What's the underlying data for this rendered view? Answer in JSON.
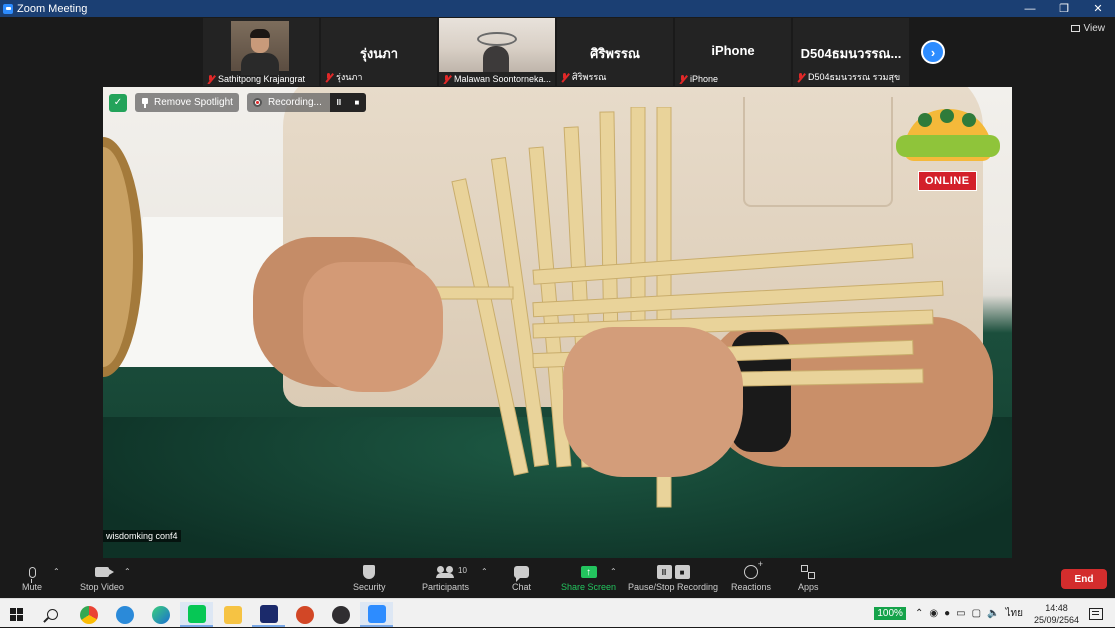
{
  "window": {
    "title": "Zoom Meeting",
    "controls": [
      "minimize",
      "restore",
      "close"
    ]
  },
  "gallery": {
    "participants": [
      {
        "label": "Sathitpong Krajangrat",
        "display": "",
        "muted": true,
        "has_video": true
      },
      {
        "label": "รุ่งนภา",
        "display": "รุ่งนภา",
        "muted": true,
        "has_video": false
      },
      {
        "label": "Malawan Soontornekа...",
        "display": "",
        "muted": true,
        "has_video": true
      },
      {
        "label": "ศิริพรรณ",
        "display": "ศิริพรรณ",
        "muted": true,
        "has_video": false
      },
      {
        "label": "iPhone",
        "display": "iPhone",
        "muted": true,
        "has_video": false
      },
      {
        "label": "D504ธมนวรรณ รวมสุข",
        "display": "D504ธมนวรรณ...",
        "muted": true,
        "has_video": false
      }
    ],
    "next_icon": "chevron-right-icon",
    "view_label": "View"
  },
  "spotlight": {
    "remove_label": "Remove Spotlight",
    "recording_label": "Recording...",
    "pause_glyph": "II",
    "stop_glyph": "■",
    "badge_text": "ONLINE",
    "camera_name": "wisdomking conf4"
  },
  "toolbar": {
    "mute": "Mute",
    "stop_video": "Stop Video",
    "security": "Security",
    "participants": "Participants",
    "participant_count": "10",
    "chat": "Chat",
    "share_screen": "Share Screen",
    "pause_stop": "Pause/Stop Recording",
    "reactions": "Reactions",
    "apps": "Apps",
    "end": "End"
  },
  "taskbar": {
    "battery": "100%",
    "language": "ไทย",
    "time": "14:48",
    "date": "25/09/2564",
    "apps": [
      "start-icon",
      "search-icon",
      "chrome-icon",
      "ie-icon",
      "edge-icon",
      "line-icon",
      "explorer-icon",
      "app-icon",
      "powerpoint-icon",
      "obs-icon",
      "zoom-icon"
    ]
  },
  "colors": {
    "titlebar": "#1b3f73",
    "accent": "#2d8cff",
    "share_green": "#23c45e",
    "end_red": "#d32d2d",
    "muted_red": "#e02828"
  }
}
